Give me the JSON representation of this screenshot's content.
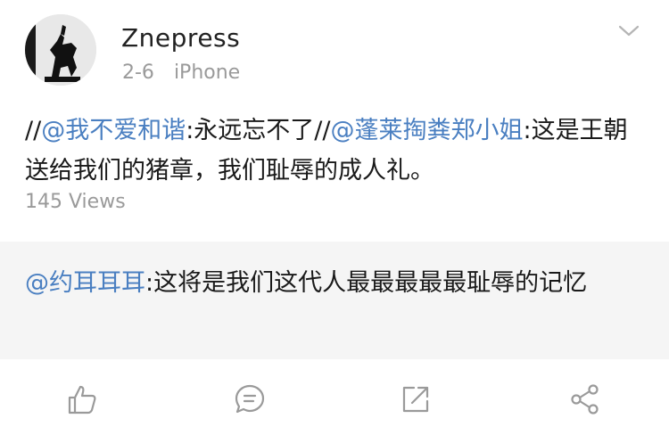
{
  "post": {
    "author": "Znepress",
    "date": "2-6",
    "device": "iPhone",
    "text_prefix_1": "//",
    "mention_1": "@我不爱和谐",
    "text_segment_1": ":永远忘不了//",
    "mention_2": "@蓬莱掏粪郑小姐",
    "text_segment_2": ":这是王朝送给我们的猪章，我们耻辱的成人礼。",
    "views": "145 Views"
  },
  "quoted": {
    "mention": "@约耳耳耳",
    "text": ":这将是我们这代人最最最最最耻辱的记忆"
  },
  "actions": {
    "icons": [
      "thumbs-up-icon",
      "comment-icon",
      "share-icon",
      "share-network-icon"
    ]
  },
  "colors": {
    "mention": "#4a7fc1",
    "secondary_text": "#9a9a9a",
    "quote_background": "#f5f5f5",
    "icon": "#9a9a9a"
  }
}
